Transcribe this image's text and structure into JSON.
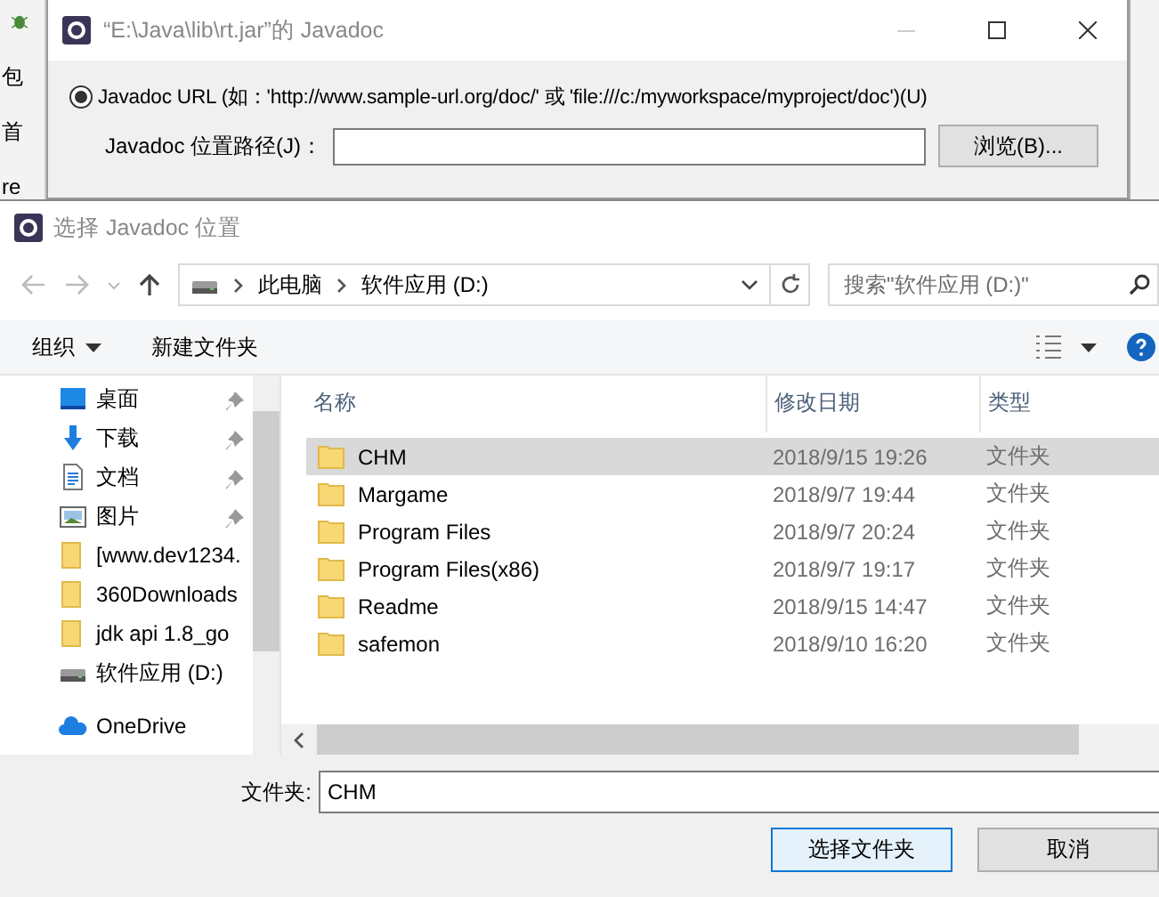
{
  "background_ide": {
    "fragments": [
      "包",
      "首",
      "re"
    ]
  },
  "javadoc_dialog": {
    "title": "“E:\\Java\\lib\\rt.jar”的 Javadoc",
    "radio": {
      "label": "Javadoc URL (如：'http://www.sample-url.org/doc/' 或 'file:///c:/myworkspace/myproject/doc')(U)",
      "selected": true
    },
    "path_label": "Javadoc 位置路径(J)：",
    "browse_button": "浏览(B)..."
  },
  "file_dialog": {
    "title": "选择 Javadoc 位置",
    "breadcrumb": [
      "此电脑",
      "软件应用 (D:)"
    ],
    "search": {
      "placeholder": "搜索\"软件应用 (D:)\""
    },
    "toolbar": {
      "organize": "组织",
      "new_folder": "新建文件夹"
    },
    "sidebar": [
      {
        "label": "桌面",
        "kind": "desktop",
        "pinned": true
      },
      {
        "label": "下载",
        "kind": "download",
        "pinned": true
      },
      {
        "label": "文档",
        "kind": "document",
        "pinned": true
      },
      {
        "label": "图片",
        "kind": "picture",
        "pinned": true
      },
      {
        "label": "[www.dev1234.",
        "kind": "folder",
        "pinned": false
      },
      {
        "label": "360Downloads",
        "kind": "folder",
        "pinned": false
      },
      {
        "label": "jdk api 1.8_go",
        "kind": "folder",
        "pinned": false
      },
      {
        "label": "软件应用 (D:)",
        "kind": "drive",
        "pinned": false
      },
      {
        "label": "OneDrive",
        "kind": "cloud",
        "pinned": false
      }
    ],
    "columns": [
      "名称",
      "修改日期",
      "类型"
    ],
    "rows": [
      {
        "name": "CHM",
        "modified": "2018/9/15 19:26",
        "type": "文件夹",
        "selected": true
      },
      {
        "name": "Margame",
        "modified": "2018/9/7 19:44",
        "type": "文件夹",
        "selected": false
      },
      {
        "name": "Program Files",
        "modified": "2018/9/7 20:24",
        "type": "文件夹",
        "selected": false
      },
      {
        "name": "Program Files(x86)",
        "modified": "2018/9/7 19:17",
        "type": "文件夹",
        "selected": false
      },
      {
        "name": "Readme",
        "modified": "2018/9/15 14:47",
        "type": "文件夹",
        "selected": false
      },
      {
        "name": "safemon",
        "modified": "2018/9/10 16:20",
        "type": "文件夹",
        "selected": false
      }
    ],
    "folder_label": "文件夹:",
    "folder_value": "CHM",
    "buttons": [
      {
        "label": "选择文件夹",
        "primary": true
      },
      {
        "label": "取消",
        "primary": false
      }
    ]
  }
}
